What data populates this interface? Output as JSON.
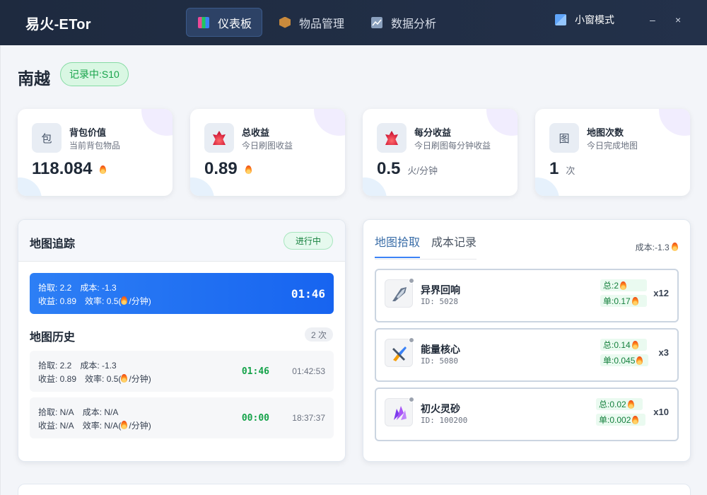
{
  "app": {
    "title": "易火-ETor"
  },
  "nav": {
    "items": [
      {
        "label": "仪表板",
        "active": true
      },
      {
        "label": "物品管理",
        "active": false
      },
      {
        "label": "数据分析",
        "active": false
      }
    ],
    "mini_mode": "小窗模式",
    "minimize": "–",
    "close": "×"
  },
  "page": {
    "title": "南越",
    "recording": "记录中:S10"
  },
  "stats": [
    {
      "icon_text": "包",
      "name": "背包价值",
      "sub": "当前背包物品",
      "value": "118.084",
      "unit": ""
    },
    {
      "icon_text": "",
      "name": "总收益",
      "sub": "今日刷图收益",
      "value": "0.89",
      "unit": ""
    },
    {
      "icon_text": "",
      "name": "每分收益",
      "sub": "今日刷图每分钟收益",
      "value": "0.5",
      "unit": "火/分钟"
    },
    {
      "icon_text": "图",
      "name": "地图次数",
      "sub": "今日完成地图",
      "value": "1",
      "unit": "次"
    }
  ],
  "tracking": {
    "title": "地图追踪",
    "status": "进行中",
    "current": {
      "pickup": "拾取: 2.2",
      "cost": "成本: -1.3",
      "income": "收益: 0.89",
      "efficiency": "效率: 0.5(",
      "efficiency_unit": "/分钟)",
      "duration": "01:46"
    }
  },
  "history": {
    "title": "地图历史",
    "count": "2 次",
    "rows": [
      {
        "pickup": "拾取: 2.2",
        "cost": "成本: -1.3",
        "income": "收益: 0.89",
        "efficiency": "效率: 0.5(",
        "efficiency_unit": "/分钟)",
        "duration": "01:46",
        "time": "01:42:53"
      },
      {
        "pickup": "拾取: N/A",
        "cost": "成本: N/A",
        "income": "收益: N/A",
        "efficiency": "效率: N/A(",
        "efficiency_unit": "/分钟)",
        "duration": "00:00",
        "time": "18:37:37"
      }
    ]
  },
  "drops": {
    "tabs": [
      "地图拾取",
      "成本记录"
    ],
    "active_tab": 0,
    "cost": "成本:-1.3",
    "items": [
      {
        "name": "异界回响",
        "id": "ID: 5028",
        "total": "总:2",
        "unit": "单:0.17",
        "qty": "x12",
        "icon": "echo-crystal-icon",
        "color": "#64748b"
      },
      {
        "name": "能量核心",
        "id": "ID: 5080",
        "total": "总:0.14",
        "unit": "单:0.045",
        "qty": "x3",
        "icon": "energy-core-icon",
        "color": "#3b82f6"
      },
      {
        "name": "初火灵砂",
        "id": "ID: 100200",
        "total": "总:0.02",
        "unit": "单:0.002",
        "qty": "x10",
        "icon": "spirit-sand-icon",
        "color": "#8b5cf6"
      }
    ]
  }
}
